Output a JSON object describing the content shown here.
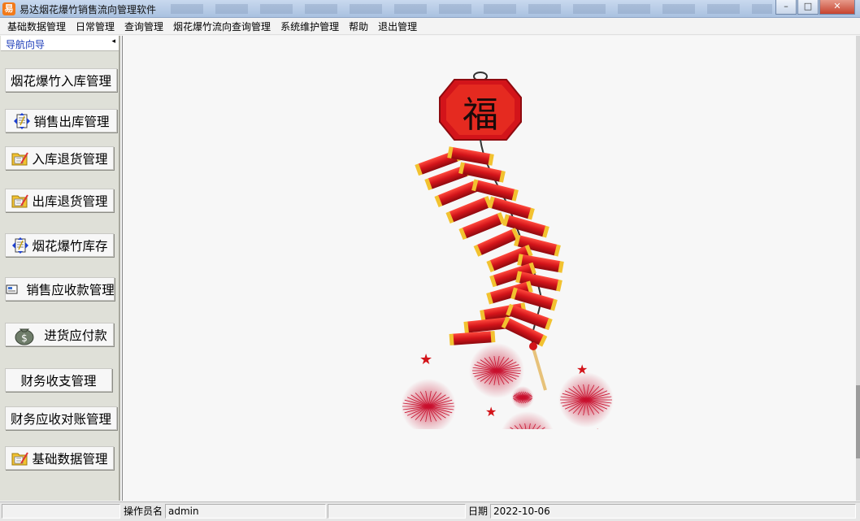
{
  "window": {
    "title": "易达烟花爆竹销售流向管理软件",
    "app_icon_glyph": "易",
    "controls": {
      "minimize": "–",
      "maximize": "□",
      "close": "✕"
    }
  },
  "menubar": {
    "items": [
      "基础数据管理",
      "日常管理",
      "查询管理",
      "烟花爆竹流向查询管理",
      "系统维护管理",
      "帮助",
      "退出管理"
    ]
  },
  "nav": {
    "title": "导航向导",
    "collapse_glyph": "◂",
    "items": [
      {
        "label": "烟花爆竹入库管理",
        "icon": "none"
      },
      {
        "label": "销售出库管理",
        "icon": "transfer-icon"
      },
      {
        "label": "入库退货管理",
        "icon": "edit-folder-icon"
      },
      {
        "label": "出库退货管理",
        "icon": "edit-folder-icon"
      },
      {
        "label": "烟花爆竹库存",
        "icon": "transfer-icon"
      },
      {
        "label": "销售应收款管理",
        "icon": "report-icon"
      },
      {
        "label": "进货应付款",
        "icon": "money-bag-icon"
      },
      {
        "label": "财务收支管理",
        "icon": "none"
      },
      {
        "label": "财务应收对账管理",
        "icon": "none"
      },
      {
        "label": "基础数据管理",
        "icon": "edit-folder-icon"
      }
    ]
  },
  "main": {
    "illustration": "firecracker-fu-icon",
    "fu_character": "福"
  },
  "statusbar": {
    "operator_label": "操作员名",
    "operator_value": "admin",
    "date_label": "日期",
    "date_value": "2022-10-06"
  },
  "colors": {
    "titlebar": "#b9cde8",
    "nav_background": "#dfe0d8",
    "main_background": "#f7f7f7",
    "firecracker_red": "#d3141a",
    "gold": "#f2c230"
  }
}
